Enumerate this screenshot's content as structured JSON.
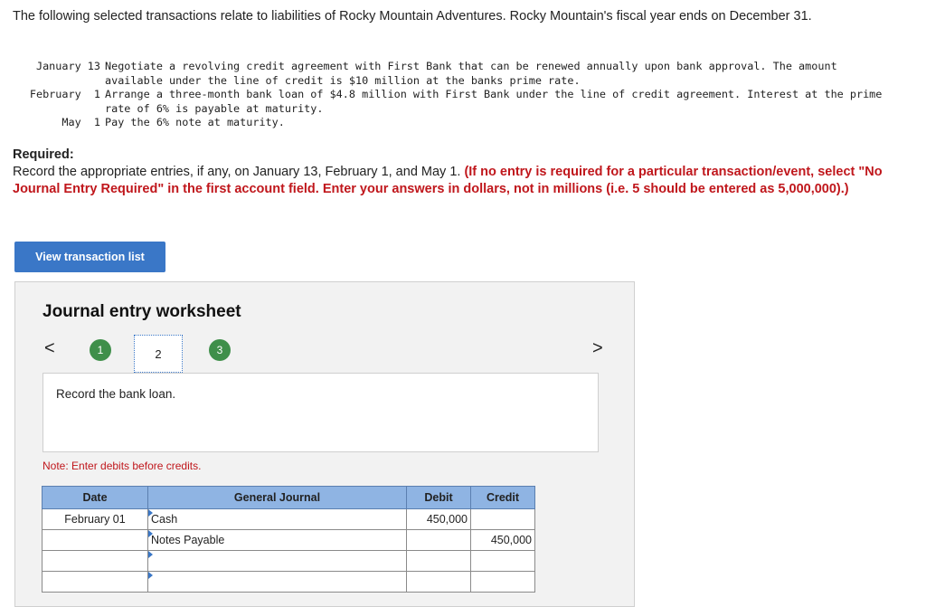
{
  "intro": "The following selected transactions relate to liabilities of Rocky Mountain Adventures. Rocky Mountain's fiscal year ends on December 31.",
  "transactions": [
    {
      "date": "January 13",
      "text": "Negotiate a revolving credit agreement with First Bank that can be renewed annually upon bank approval. The amount available under the line of credit is $10 million at the banks prime rate."
    },
    {
      "date": "February  1",
      "text": "Arrange a three-month bank loan of $4.8 million with First Bank under the line of credit agreement. Interest at the prime rate of 6% is payable at maturity."
    },
    {
      "date": "May  1",
      "text": "Pay the 6% note at maturity."
    }
  ],
  "required": {
    "heading": "Required:",
    "text": "Record the appropriate entries, if any, on January 13, February 1, and May 1. ",
    "instruction": "(If no entry is required for a particular transaction/event, select \"No Journal Entry Required\" in the first account field. Enter your answers in dollars, not in millions (i.e. 5 should be entered as 5,000,000).)"
  },
  "view_button": "View transaction list",
  "worksheet": {
    "title": "Journal entry worksheet",
    "prev": "<",
    "next": ">",
    "steps": [
      "1",
      "2",
      "3"
    ],
    "description": "Record the bank loan.",
    "note": "Note: Enter debits before credits."
  },
  "journal": {
    "headers": [
      "Date",
      "General Journal",
      "Debit",
      "Credit"
    ],
    "rows": [
      {
        "date": "February 01",
        "account": "Cash",
        "debit": "450,000",
        "credit": ""
      },
      {
        "date": "",
        "account": "Notes Payable",
        "debit": "",
        "credit": "450,000"
      },
      {
        "date": "",
        "account": "",
        "debit": "",
        "credit": ""
      },
      {
        "date": "",
        "account": "",
        "debit": "",
        "credit": ""
      }
    ]
  }
}
